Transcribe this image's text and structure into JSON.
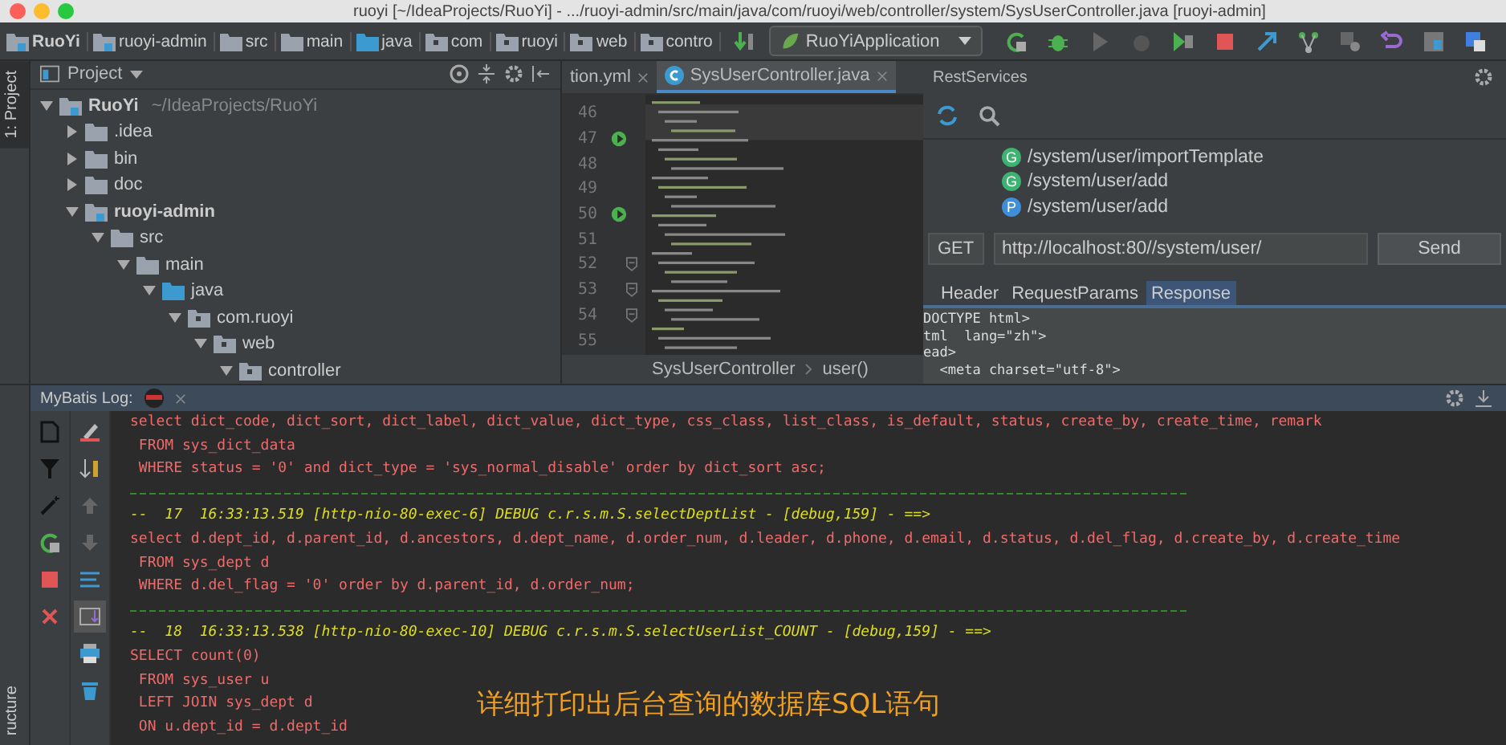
{
  "window": {
    "title": "ruoyi [~/IdeaProjects/RuoYi] - .../ruoyi-admin/src/main/java/com/ruoyi/web/controller/system/SysUserController.java [ruoyi-admin]"
  },
  "breadcrumbs": [
    {
      "label": "RuoYi",
      "kind": "module"
    },
    {
      "label": "ruoyi-admin",
      "kind": "module"
    },
    {
      "label": "src",
      "kind": "folder"
    },
    {
      "label": "main",
      "kind": "folder"
    },
    {
      "label": "java",
      "kind": "source"
    },
    {
      "label": "com",
      "kind": "package"
    },
    {
      "label": "ruoyi",
      "kind": "package"
    },
    {
      "label": "web",
      "kind": "package"
    },
    {
      "label": "contro",
      "kind": "package"
    }
  ],
  "run_config": {
    "label": "RuoYiApplication"
  },
  "side_tabs": {
    "project": "1: Project",
    "structure": "ructure"
  },
  "project": {
    "title": "Project",
    "tree": [
      {
        "label": "RuoYi",
        "path": "~/IdeaProjects/RuoYi",
        "kind": "module",
        "expanded": true,
        "children": [
          {
            "label": ".idea",
            "kind": "folder",
            "expanded": false
          },
          {
            "label": "bin",
            "kind": "folder",
            "expanded": false
          },
          {
            "label": "doc",
            "kind": "folder",
            "expanded": false
          },
          {
            "label": "ruoyi-admin",
            "kind": "module",
            "expanded": true,
            "children": [
              {
                "label": "src",
                "kind": "folder",
                "expanded": true,
                "children": [
                  {
                    "label": "main",
                    "kind": "folder",
                    "expanded": true,
                    "children": [
                      {
                        "label": "java",
                        "kind": "source",
                        "expanded": true,
                        "children": [
                          {
                            "label": "com.ruoyi",
                            "kind": "package",
                            "expanded": true,
                            "children": [
                              {
                                "label": "web",
                                "kind": "package",
                                "expanded": true,
                                "children": [
                                  {
                                    "label": "controller",
                                    "kind": "package",
                                    "expanded": true
                                  }
                                ]
                              }
                            ]
                          }
                        ]
                      }
                    ]
                  }
                ]
              }
            ]
          }
        ]
      }
    ]
  },
  "editor": {
    "tabs": [
      {
        "label": "tion.yml",
        "selected": false
      },
      {
        "label": "SysUserController.java",
        "selected": true
      }
    ],
    "lines": [
      {
        "number": "46",
        "kind": "plain"
      },
      {
        "number": "47",
        "kind": "run"
      },
      {
        "number": "48",
        "kind": "plain"
      },
      {
        "number": "49",
        "kind": "plain"
      },
      {
        "number": "50",
        "kind": "run"
      },
      {
        "number": "51",
        "kind": "plain"
      },
      {
        "number": "52",
        "kind": "fold"
      },
      {
        "number": "53",
        "kind": "fold"
      },
      {
        "number": "54",
        "kind": "fold"
      },
      {
        "number": "55",
        "kind": "plain"
      }
    ],
    "breadcrumb": [
      "SysUserController",
      "user()"
    ]
  },
  "rest": {
    "title": "RestServices",
    "services": [
      {
        "method": "G",
        "path": "/system/user/importTemplate",
        "color": "#3cb371"
      },
      {
        "method": "G",
        "path": "/system/user/add",
        "color": "#3cb371"
      },
      {
        "method": "P",
        "path": "/system/user/add",
        "color": "#3f8fd8"
      }
    ],
    "method": "GET",
    "url": "http://localhost:80//system/user/",
    "send": "Send",
    "tabs": [
      {
        "label": "Header",
        "selected": false
      },
      {
        "label": "RequestParams",
        "selected": false
      },
      {
        "label": "Response",
        "selected": true
      }
    ],
    "response": [
      "DOCTYPE html>",
      "tml  lang=\"zh\">",
      "ead>",
      "  <meta charset=\"utf-8\">"
    ]
  },
  "mybatis": {
    "title": "MyBatis Log:",
    "lines": [
      {
        "kind": "sql",
        "text": "select dict_code, dict_sort, dict_label, dict_value, dict_type, css_class, list_class, is_default, status, create_by, create_time, remark"
      },
      {
        "kind": "sql",
        "text": " FROM sys_dict_data"
      },
      {
        "kind": "sql",
        "text": " WHERE status = '0' and dict_type = 'sys_normal_disable' order by dict_sort asc;"
      },
      {
        "kind": "separator"
      },
      {
        "kind": "debug",
        "text": "--  17  16:33:13.519 [http-nio-80-exec-6] DEBUG c.r.s.m.S.selectDeptList - [debug,159] - ==>"
      },
      {
        "kind": "sql",
        "text": "select d.dept_id, d.parent_id, d.ancestors, d.dept_name, d.order_num, d.leader, d.phone, d.email, d.status, d.del_flag, d.create_by, d.create_time"
      },
      {
        "kind": "sql",
        "text": " FROM sys_dept d"
      },
      {
        "kind": "sql",
        "text": " WHERE d.del_flag = '0' order by d.parent_id, d.order_num;"
      },
      {
        "kind": "separator"
      },
      {
        "kind": "debug",
        "text": "--  18  16:33:13.538 [http-nio-80-exec-10] DEBUG c.r.s.m.S.selectUserList_COUNT - [debug,159] - ==>"
      },
      {
        "kind": "sql",
        "text": "SELECT count(0)"
      },
      {
        "kind": "sql",
        "text": " FROM sys_user u"
      },
      {
        "kind": "sql",
        "text": " LEFT JOIN sys_dept d"
      },
      {
        "kind": "sql",
        "text": " ON u.dept_id = d.dept_id"
      }
    ]
  },
  "caption": "详细打印出后台查询的数据库SQL语句"
}
